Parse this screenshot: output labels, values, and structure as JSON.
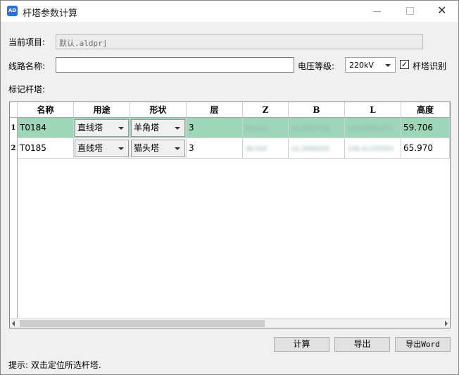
{
  "window": {
    "title": "杆塔参数计算",
    "icon_text": "AD"
  },
  "form": {
    "project_label": "当前项目:",
    "project_value": "默认.aldprj",
    "line_label": "线路名称:",
    "line_value": "",
    "voltage_label": "电压等级:",
    "voltage_value": "220kV",
    "tower_recognize_label": "杆塔识别",
    "tower_recognize_checked": "✓",
    "marked_towers_label": "标记杆塔:"
  },
  "table": {
    "columns": [
      "名称",
      "用途",
      "形状",
      "层",
      "Z",
      "B",
      "L",
      "高度"
    ],
    "rows": [
      {
        "index": "1",
        "name": "T0184",
        "usage": "直线塔",
        "shape": "羊角塔",
        "layer": "3",
        "z": "92.812",
        "b": "34.2987718",
        "l": "108.40861471",
        "height": "59.706",
        "selected": true
      },
      {
        "index": "2",
        "name": "T0185",
        "usage": "直线塔",
        "shape": "猫头塔",
        "layer": "3",
        "z": "38.000",
        "b": "34.2968059",
        "l": "108.41335593",
        "height": "65.970",
        "selected": false
      }
    ]
  },
  "buttons": {
    "calculate": "计算",
    "export": "导出",
    "export_word": "导出Word"
  },
  "status": {
    "hint": "提示: 双击定位所选杆塔."
  }
}
